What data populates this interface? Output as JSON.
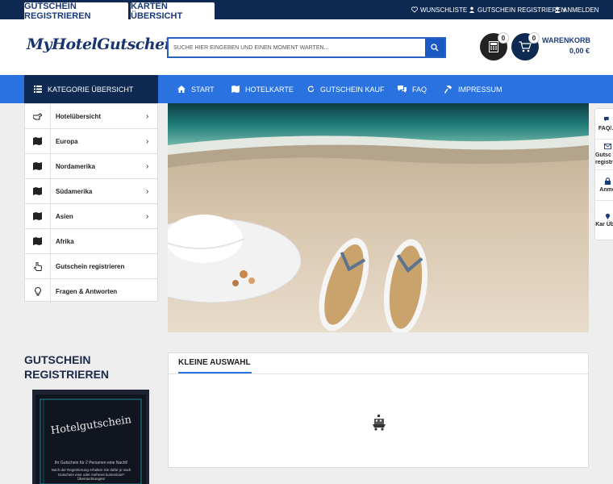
{
  "topbar": {
    "tabs": [
      "GUTSCHEIN REGISTRIEREN",
      "KARTEN ÜBERSICHT"
    ],
    "links": [
      "WUNSCHLISTE",
      "GUTSCHEIN REGISTRIEREN",
      "ANMELDEN"
    ]
  },
  "header": {
    "logo": "MyHotelGutschein",
    "search_placeholder": "SUCHE HIER EINGEBEN UND EINEN MOMENT WARTEN...",
    "calc_count": "0",
    "cart_count": "0",
    "cart_label": "WARENKORB",
    "cart_amount": "0,00 €"
  },
  "nav": {
    "category_label": "KATEGORIE ÜBERSICHT",
    "items": [
      "START",
      "HOTELKARTE",
      "GUTSCHEIN KAUF",
      "FAQ",
      "IMPRESSUM"
    ]
  },
  "categories": [
    {
      "label": "Hotelübersicht",
      "icon": "pointing-hand-icon",
      "chevron": true
    },
    {
      "label": "Europa",
      "icon": "map-icon",
      "chevron": true
    },
    {
      "label": "Nordamerika",
      "icon": "map-icon",
      "chevron": true
    },
    {
      "label": "Südamerika",
      "icon": "map-icon",
      "chevron": true
    },
    {
      "label": "Asien",
      "icon": "map-icon",
      "chevron": true
    },
    {
      "label": "Afrika",
      "icon": "map-icon",
      "chevron": false
    },
    {
      "label": "Gutschein registrieren",
      "icon": "hand-pointer-icon",
      "chevron": false
    },
    {
      "label": "Fragen & Antworten",
      "icon": "lightbulb-icon",
      "chevron": false
    }
  ],
  "right_panel": [
    "FAQ/...",
    "Gutsc registr",
    "Anme",
    "Kar Über"
  ],
  "voucher_section": {
    "title": "GUTSCHEIN REGISTRIEREN",
    "card_title": "Hotelgutschein",
    "card_line1": "Ihr Gutschein für 2 Personen eine Nacht!",
    "card_line2": "Nach der Registrierung erhalten Sie dafür je nach Gutschein eine oder mehrere kostenlose* Übernachtungen!"
  },
  "kleine_auswahl": {
    "title": "KLEINE AUSWAHL"
  },
  "colors": {
    "navy": "#0e2a52",
    "nav_blue": "#2a72e0",
    "search_blue": "#1a58c4"
  }
}
